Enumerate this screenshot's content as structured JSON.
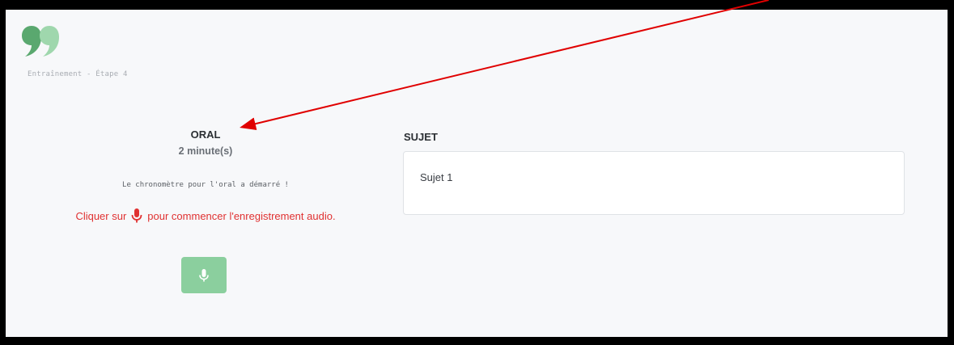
{
  "header": {
    "logo_icon": "quote-logo-icon",
    "breadcrumb": "Entraînement - Étape 4"
  },
  "oral": {
    "title": "ORAL",
    "duration": "2 minute(s)",
    "chrono_status": "Le chronomètre pour l'oral a démarré !",
    "instruction_before": "Cliquer sur",
    "instruction_after": "pour commencer l'enregistrement audio.",
    "instruction_icon": "microphone-icon",
    "record_button_icon": "microphone-icon"
  },
  "sujet": {
    "title": "SUJET",
    "text": "Sujet 1"
  },
  "colors": {
    "brand_green": "#8bcf9e",
    "instruction_red": "#e03131",
    "annotation_arrow": "#e00000"
  }
}
